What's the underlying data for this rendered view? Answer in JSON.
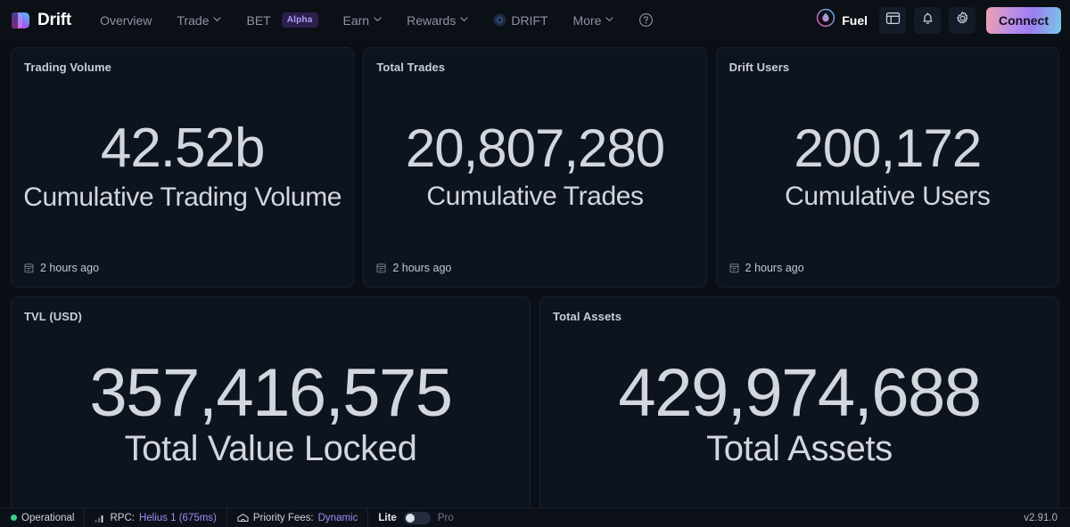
{
  "navbar": {
    "brand": "Drift",
    "brand_logo_icon": "drift-cube-logo",
    "items": [
      {
        "label": "Overview",
        "icon": "",
        "caret": false,
        "badge": ""
      },
      {
        "label": "Trade",
        "icon": "",
        "caret": true,
        "badge": ""
      },
      {
        "label": "BET",
        "icon": "",
        "caret": false,
        "badge": "Alpha"
      },
      {
        "label": "Earn",
        "icon": "",
        "caret": true,
        "badge": ""
      },
      {
        "label": "Rewards",
        "icon": "",
        "caret": true,
        "badge": ""
      },
      {
        "label": "DRIFT",
        "icon": "drift-token-icon",
        "caret": false,
        "badge": ""
      },
      {
        "label": "More",
        "icon": "",
        "caret": true,
        "badge": ""
      }
    ],
    "help_icon": "question-circle-icon",
    "fuel_label": "Fuel",
    "fuel_icon": "fuel-droplet-icon",
    "icon_buttons": [
      {
        "name": "layout-panel-icon"
      },
      {
        "name": "bell-icon"
      },
      {
        "name": "gear-icon"
      }
    ],
    "connect_label": "Connect"
  },
  "cards": {
    "trading_volume": {
      "title": "Trading Volume",
      "value": "42.52b",
      "label": "Cumulative Trading Volume",
      "timestamp": "2 hours ago",
      "timestamp_icon": "calendar-icon"
    },
    "total_trades": {
      "title": "Total Trades",
      "value": "20,807,280",
      "label": "Cumulative Trades",
      "timestamp": "2 hours ago",
      "timestamp_icon": "calendar-icon"
    },
    "drift_users": {
      "title": "Drift Users",
      "value": "200,172",
      "label": "Cumulative Users",
      "timestamp": "2 hours ago",
      "timestamp_icon": "calendar-icon"
    },
    "tvl": {
      "title": "TVL (USD)",
      "value": "357,416,575",
      "label": "Total Value Locked"
    },
    "total_assets": {
      "title": "Total Assets",
      "value": "429,974,688",
      "label": "Total Assets"
    }
  },
  "footer": {
    "status_label": "Operational",
    "status_color": "#3ecf8e",
    "rpc_prefix": "RPC:",
    "rpc_value": "Helius 1 (675ms)",
    "rpc_icon": "signal-bars-icon",
    "fees_prefix": "Priority Fees:",
    "fees_value": "Dynamic",
    "fees_icon": "gas-icon",
    "mode_lite": "Lite",
    "mode_pro": "Pro",
    "mode_selected": "Lite",
    "version": "v2.91.0"
  }
}
